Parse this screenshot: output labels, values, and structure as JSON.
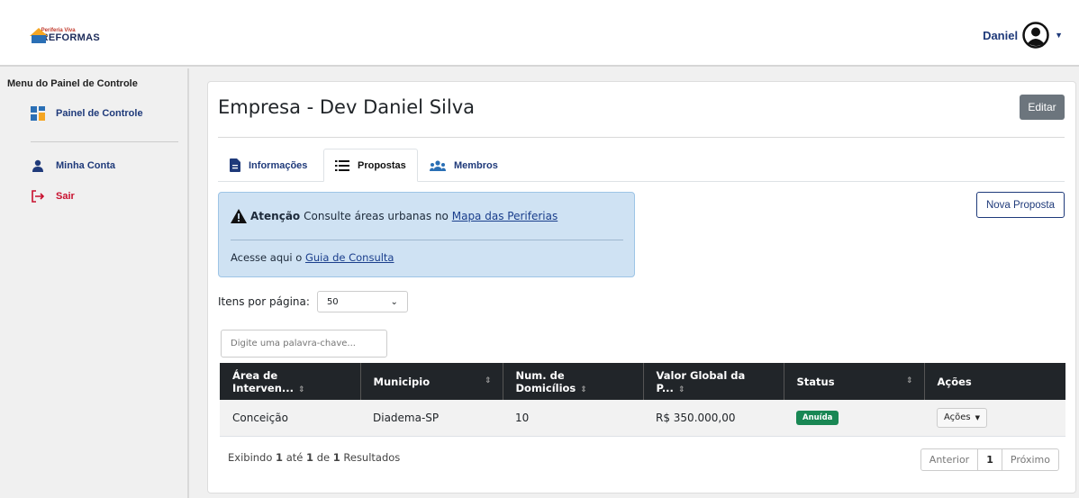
{
  "brand": {
    "line1": "Periferia Viva",
    "line2": "REFORMAS"
  },
  "user": {
    "name": "Daniel"
  },
  "sidebar": {
    "title": "Menu do Painel de Controle",
    "items": [
      {
        "label": "Painel de Controle",
        "icon": "dashboard-icon"
      },
      {
        "label": "Minha Conta",
        "icon": "user-icon"
      },
      {
        "label": "Sair",
        "icon": "logout-icon"
      }
    ]
  },
  "page": {
    "title": "Empresa - Dev Daniel Silva",
    "edit_label": "Editar"
  },
  "tabs": [
    {
      "label": "Informações",
      "icon": "document-icon"
    },
    {
      "label": "Propostas",
      "icon": "list-icon",
      "active": true
    },
    {
      "label": "Membros",
      "icon": "users-icon"
    }
  ],
  "alert": {
    "strong": "Atenção",
    "text": "Consulte áreas urbanas no",
    "link1": "Mapa das Periferias",
    "line2_text": "Acesse aqui o",
    "link2": "Guia de Consulta"
  },
  "new_proposal_label": "Nova Proposta",
  "per_page": {
    "label": "Itens por página:",
    "value": "50"
  },
  "search": {
    "placeholder": "Digite uma palavra-chave..."
  },
  "table": {
    "headers": [
      "Área de Interven...",
      "Municipio",
      "Num. de Domicílios",
      "Valor Global da P...",
      "Status",
      "Ações"
    ],
    "rows": [
      {
        "area": "Conceição",
        "municipio": "Diadema-SP",
        "domicilios": "10",
        "valor": "R$ 350.000,00",
        "status": "Anuída",
        "acoes": "Ações"
      }
    ]
  },
  "footer": {
    "pre": "Exibindo",
    "from": "1",
    "mid": "até",
    "to": "1",
    "of": "de",
    "total": "1",
    "post": "Resultados"
  },
  "pager": {
    "prev": "Anterior",
    "current": "1",
    "next": "Próximo"
  },
  "colors": {
    "accent": "#1f3a7a",
    "danger": "#c8102e",
    "success": "#198754",
    "alert_bg": "#cfe2f3",
    "header_dark": "#212529"
  }
}
